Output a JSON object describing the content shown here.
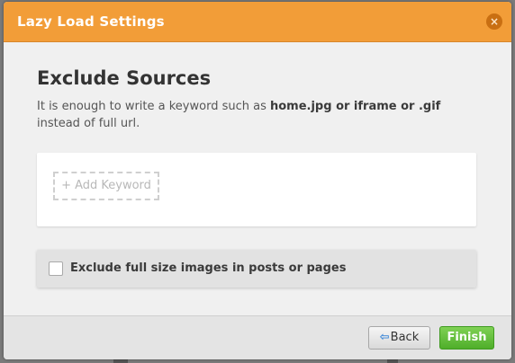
{
  "dialog": {
    "title": "Lazy Load Settings",
    "close_glyph": "×"
  },
  "main": {
    "heading": "Exclude Sources",
    "desc_prefix": "It is enough to write a keyword such as ",
    "desc_keywords": "home.jpg or iframe or .gif",
    "desc_suffix": " instead of full url.",
    "add_keyword_label": "+ Add Keyword",
    "option_label": "Exclude full size images in posts or pages",
    "option_checked": false
  },
  "footer": {
    "back_arrow": "⇦",
    "back_label": "Back",
    "finish_label": "Finish"
  },
  "colors": {
    "titlebar": "#f29d38",
    "finish_button": "#5cb832",
    "back_arrow": "#3a86d8"
  }
}
